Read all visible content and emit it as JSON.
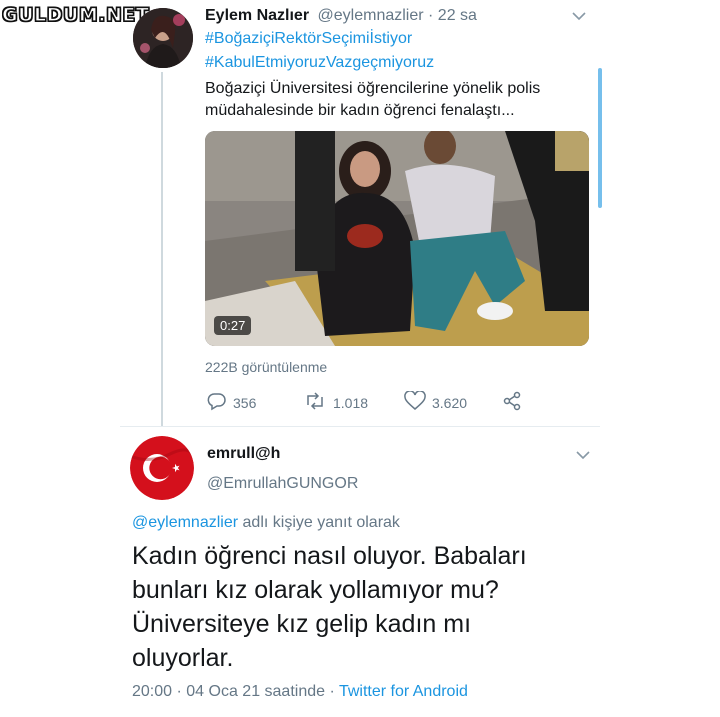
{
  "watermark": "GULDUM.NET",
  "tweet1": {
    "display_name": "Eylem Nazlıer",
    "handle_time": "@eylemnazlier · 22 sa",
    "hashtag1": "#BoğaziçiRektörSeçimiİstiyor",
    "hashtag2": "#KabulEtmiyoruzVazgeçmiyoruz",
    "text": "Boğaziçi Üniversitesi öğrencilerine yönelik polis müdahalesinde bir kadın öğrenci fenalaştı...",
    "video_duration": "0:27",
    "views": "222B görüntülenme",
    "replies": "356",
    "retweets": "1.018",
    "likes": "3.620"
  },
  "tweet2": {
    "display_name": "emrull@h",
    "handle": "@EmrullahGUNGOR",
    "reply_mention": "@eylemnazlier",
    "reply_suffix": "adlı kişiye yanıt olarak",
    "text": "Kadın öğrenci nasıl oluyor. Babaları bunları kız olarak yollamıyor mu? Üniversiteye kız gelip kadın mı oluyorlar.",
    "timestamp": "20:00 · 04 Oca 21 saatinde ·",
    "source": "Twitter for Android"
  },
  "colors": {
    "link": "#1b95e0",
    "muted": "#657786",
    "flag_red": "#e30a17"
  },
  "icons": [
    "reply-icon",
    "retweet-icon",
    "like-icon",
    "share-icon",
    "chevron-down-icon"
  ]
}
